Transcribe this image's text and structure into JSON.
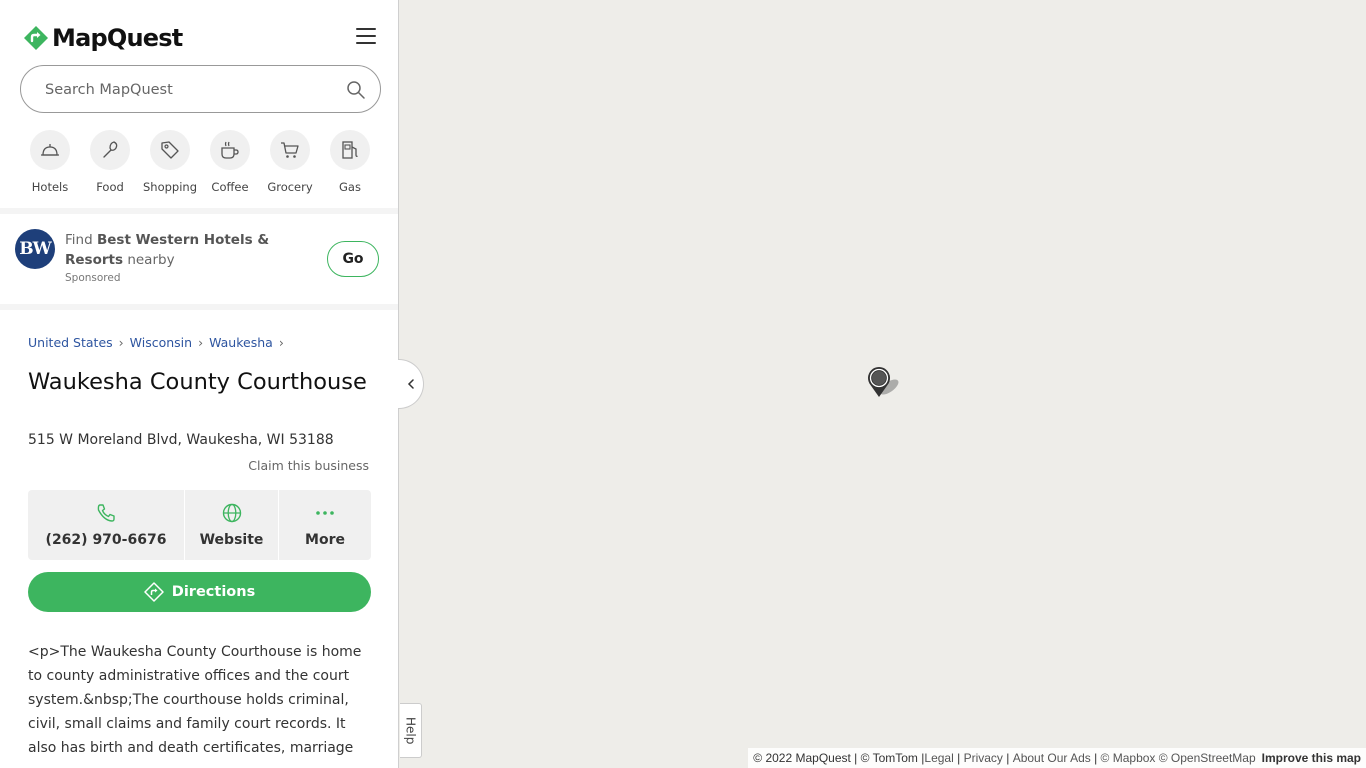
{
  "header": {
    "brand": "MapQuest"
  },
  "search": {
    "placeholder": "Search MapQuest"
  },
  "categories": [
    {
      "label": "Hotels",
      "icon": "bell-icon"
    },
    {
      "label": "Food",
      "icon": "utensils-icon"
    },
    {
      "label": "Shopping",
      "icon": "tag-icon"
    },
    {
      "label": "Coffee",
      "icon": "coffee-icon"
    },
    {
      "label": "Grocery",
      "icon": "cart-icon"
    },
    {
      "label": "Gas",
      "icon": "gas-pump-icon"
    }
  ],
  "ad": {
    "logo_text": "BW",
    "find": "Find",
    "brand": "Best Western Hotels & Resorts",
    "nearby": "nearby",
    "sponsored": "Sponsored",
    "go_label": "Go"
  },
  "breadcrumb": [
    "United States",
    "Wisconsin",
    "Waukesha"
  ],
  "place": {
    "title": "Waukesha County Courthouse",
    "address": "515 W Moreland Blvd, Waukesha, WI 53188",
    "claim": "Claim this business",
    "phone": "(262) 970-6676",
    "website_label": "Website",
    "more_label": "More",
    "directions_label": "Directions",
    "description": "<p>The Waukesha County Courthouse is home to county administrative offices and the court system.&nbsp;The courthouse holds criminal, civil, small claims and family court records. It also has birth and death certificates, marriage"
  },
  "map": {
    "help_label": "Help",
    "attribution": {
      "copyright": "© 2022 MapQuest | © TomTom | ",
      "legal": "Legal",
      "privacy": "Privacy",
      "ads": "About Our Ads",
      "mapbox": "© Mapbox © OpenStreetMap",
      "improve": "Improve this map"
    }
  },
  "colors": {
    "accent": "#3db55f",
    "link": "#2e55a0",
    "map_bg": "#eeede9",
    "bw_blue": "#1e3f7a"
  }
}
